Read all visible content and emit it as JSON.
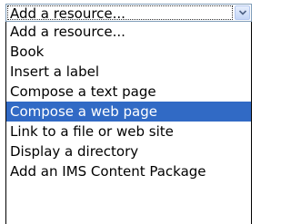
{
  "select": {
    "value": "Add a resource...",
    "arrow_icon": "chevron-down-icon",
    "options": [
      "Add a resource...",
      "Book",
      "Insert a label",
      "Compose a text page",
      "Compose a web page",
      "Link to a file or web site",
      "Display a directory",
      "Add an IMS Content Package"
    ],
    "highlighted_option": "Compose a web page"
  },
  "colors": {
    "highlight_bg": "#316ac5",
    "highlight_text": "#ffffff",
    "border": "#7f9db9"
  }
}
